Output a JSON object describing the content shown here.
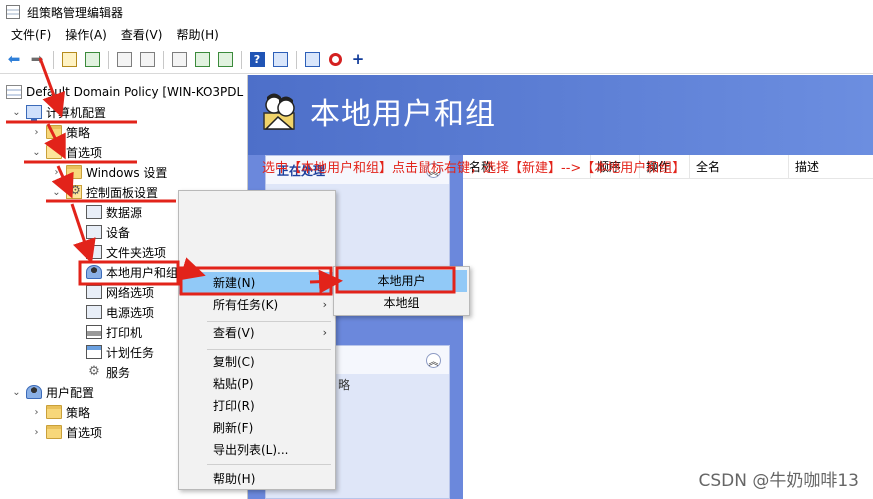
{
  "window": {
    "title": "组策略管理编辑器"
  },
  "menubar": [
    "文件(F)",
    "操作(A)",
    "查看(V)",
    "帮助(H)"
  ],
  "toolbar": [
    "back-icon",
    "forward-icon",
    "folder-up-icon",
    "show-hide-tree-icon",
    "copy-icon",
    "paste-icon",
    "print-icon",
    "refresh-icon",
    "export-icon",
    "help-icon",
    "properties-icon",
    "new-window-icon",
    "stop-icon",
    "add-icon"
  ],
  "tree": {
    "root": "Default Domain Policy [WIN-KO3PDL",
    "computer_config": "计算机配置",
    "policies": "策略",
    "preferences": "首选项",
    "windows_settings": "Windows 设置",
    "control_panel_settings": "控制面板设置",
    "data_sources": "数据源",
    "devices": "设备",
    "folder_options": "文件夹选项",
    "local_users_groups": "本地用户和组",
    "network_options": "网络选项",
    "power_options": "电源选项",
    "printers": "打印机",
    "scheduled_tasks": "计划任务",
    "services": "服务",
    "user_config": "用户配置",
    "user_policies": "策略",
    "user_preferences": "首选项"
  },
  "content": {
    "banner_title": "本地用户和组",
    "task_header": "正在处理",
    "task_header_2_fragment": "略",
    "columns": [
      "名称",
      "顺序",
      "操作",
      "全名",
      "描述"
    ]
  },
  "annotation": "选中【本地用户和组】点击鼠标右键，选择【新建】-->【本地用户和组】",
  "context_menu": {
    "new": "新建(N)",
    "all_tasks": "所有任务(K)",
    "view": "查看(V)",
    "copy": "复制(C)",
    "paste": "粘贴(P)",
    "print": "打印(R)",
    "refresh": "刷新(F)",
    "export": "导出列表(L)...",
    "help": "帮助(H)"
  },
  "submenu": {
    "local_user": "本地用户",
    "local_group": "本地组"
  },
  "watermark": "CSDN @牛奶咖啡13",
  "colors": {
    "banner": "#5b7bd5",
    "annotation": "#e2231a",
    "menu_highlight": "#91c9f7"
  }
}
